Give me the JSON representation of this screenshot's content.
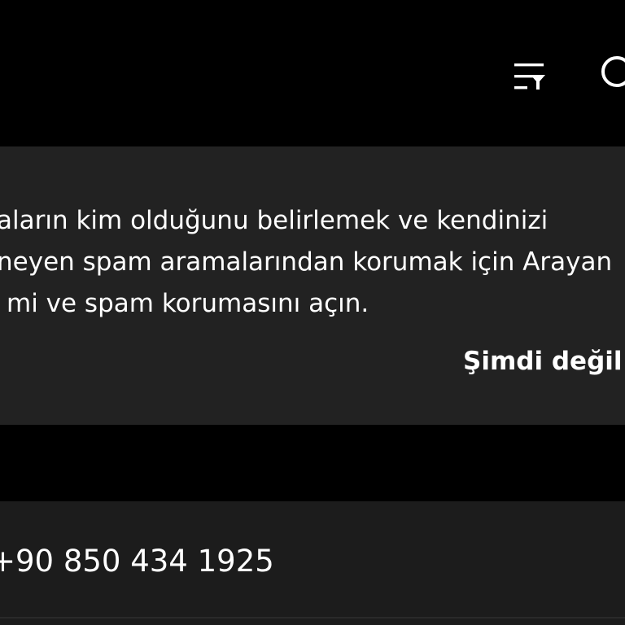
{
  "toolbar": {
    "filter_icon": "filter-list-icon",
    "search_icon": "search-icon"
  },
  "banner": {
    "lines": [
      "aların kim olduğunu belirlemek ve kendinizi",
      "neyen spam aramalarından korumak için Arayan",
      "mi ve spam korumasını açın."
    ],
    "dismiss_label": "Şimdi değil"
  },
  "call_log": {
    "items": [
      {
        "number": "+90 850 434 1925"
      }
    ]
  },
  "colors": {
    "background": "#000000",
    "banner_background": "#222222",
    "row_background": "#1c1c1c",
    "text": "#ffffff"
  }
}
